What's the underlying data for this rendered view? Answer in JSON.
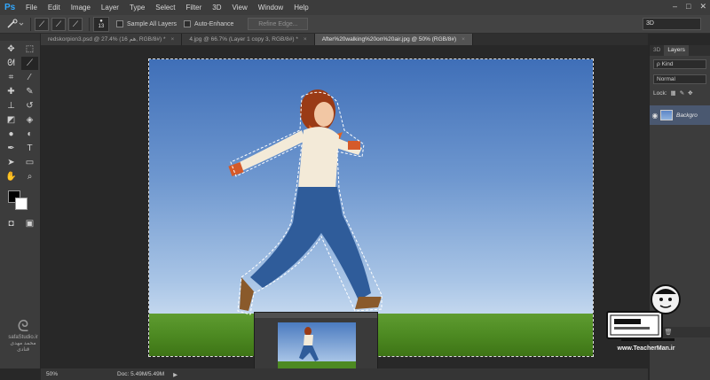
{
  "app": {
    "logo": "Ps"
  },
  "menu": [
    "File",
    "Edit",
    "Image",
    "Layer",
    "Type",
    "Select",
    "Filter",
    "3D",
    "View",
    "Window",
    "Help"
  ],
  "window_controls": [
    "–",
    "□",
    "✕"
  ],
  "options": {
    "brush_size": "13",
    "sample_all_layers": "Sample All Layers",
    "auto_enhance": "Auto-Enhance",
    "refine_edge": "Refine Edge...",
    "mode": "3D"
  },
  "tabs": [
    {
      "label": "redskorpion3.psd @ 27.4% (هم 16, RGB/8#) *",
      "close": "×"
    },
    {
      "label": "4.jpg @ 66.7% (Layer 1 copy 3, RGB/8#) *",
      "close": "×"
    },
    {
      "label": "After%20walking%20on%20air.jpg @ 50% (RGB/8#)",
      "close": "×"
    }
  ],
  "status": {
    "zoom": "50%",
    "doc": "Doc: 5.49M/5.49M",
    "arrow": "▶"
  },
  "panels": {
    "tabs": [
      "3D",
      "Layers"
    ],
    "kind": "ρ Kind",
    "blend": "Normal",
    "lock": "Lock:",
    "layer_name": "Backgro"
  },
  "watermark": {
    "left_name": "safaStudio.ir",
    "left_sub": "محمد مهدی قنادی",
    "right_site": "www.TeacherMan.ir"
  },
  "colors": {
    "accent": "#31a8ff",
    "foreground": "#000000",
    "background": "#ffffff"
  }
}
